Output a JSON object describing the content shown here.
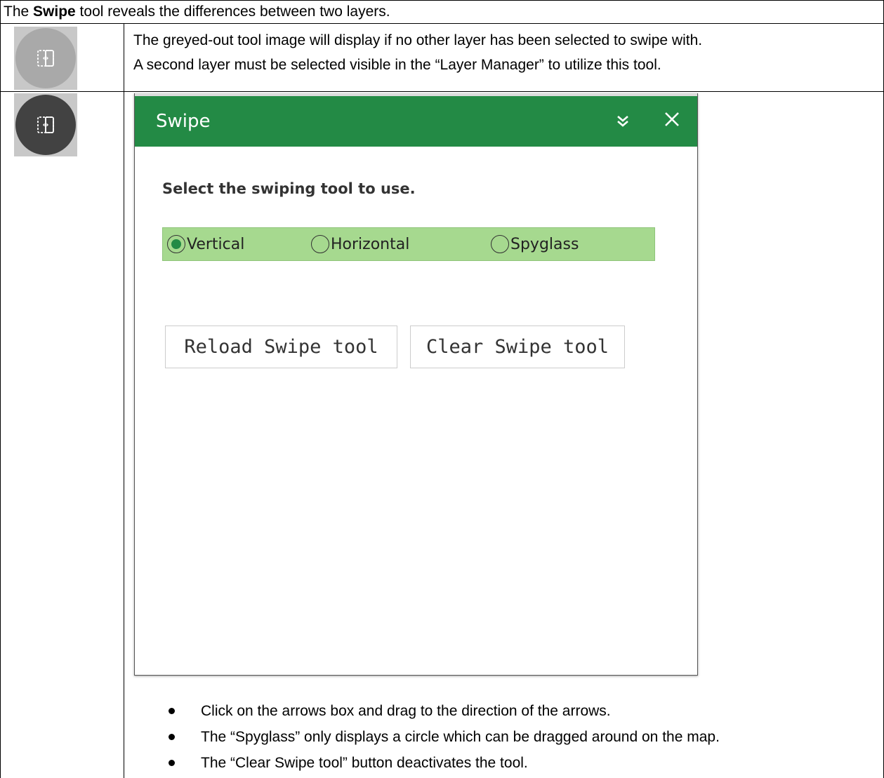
{
  "intro": {
    "prefix": "The ",
    "tool_name": "Swipe",
    "suffix": " tool reveals the differences between two layers."
  },
  "disabled_row": {
    "icon": "swipe-tool-disabled-icon",
    "line1": "The greyed-out tool image will display if no other layer has been selected to swipe with.",
    "line2": "A second layer must be selected visible in the “Layer Manager” to utilize this tool."
  },
  "active_row": {
    "icon": "swipe-tool-active-icon",
    "widget": {
      "title": "Swipe",
      "header_color": "#238a45",
      "collapse_icon": "double-chevron-down-icon",
      "close_icon": "close-icon",
      "prompt": "Select the swiping tool to use.",
      "radio_bar_color": "#a6d98f",
      "options": [
        {
          "label": "Vertical",
          "selected": true
        },
        {
          "label": "Horizontal",
          "selected": false
        },
        {
          "label": "Spyglass",
          "selected": false
        }
      ],
      "buttons": {
        "reload": "Reload Swipe tool",
        "clear": "Clear Swipe tool"
      }
    },
    "bullets": [
      "Click on the arrows box and drag to the direction of the arrows.",
      "The “Spyglass” only displays a circle which can be dragged around on the map.",
      "The “Clear Swipe tool” button deactivates the tool."
    ]
  }
}
